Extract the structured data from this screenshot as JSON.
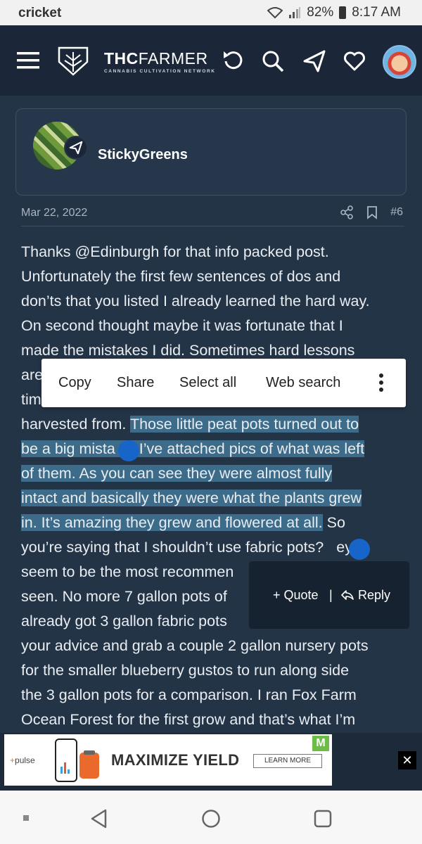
{
  "status_bar": {
    "carrier": "cricket",
    "battery": "82%",
    "time": "8:17 AM"
  },
  "header": {
    "logo_bold": "THC",
    "logo_light": "FARMER",
    "tagline": "CANNABIS CULTIVATION NETWORK",
    "icons": [
      "menu-icon",
      "logo-icon",
      "refresh-icon",
      "search-icon",
      "send-icon",
      "heart-icon",
      "avatar"
    ]
  },
  "post": {
    "username": "StickyGreens",
    "date": "Mar 22, 2022",
    "number": "#6",
    "lines": [
      "Thanks @Edinburgh for that info packed post.",
      "Unfortunately the first few sentences of dos and",
      "don’ts that you listed I already learned the hard way.",
      "On second thought maybe it was fortunate that I",
      "made the mistakes I did. Sometimes hard lessons",
      "are",
      "tim",
      "harvested from.",
      "Those little peat pots turned out to",
      "be a big mista",
      ". I’ve attached pics of what was left",
      "of them. As you can see they were almost fully",
      "intact and basically they were what the plants grew",
      "in. It’s amazing they grew and flowered at all.",
      "So",
      "you’re saying that I shouldn’t use fabric pots?",
      "ey",
      "seem to be the most recommen",
      "seen. No more 7 gallon pots of",
      "already got 3 gallon fabric pots",
      "your advice and grab a couple 2 gallon nursery pots",
      "for the smaller blueberry gustos to run along side",
      "the 3 gallon pots for a comparison. I ran Fox Farm",
      "Ocean Forest for the first grow and that’s what I’m"
    ]
  },
  "selection_toolbar": {
    "copy": "Copy",
    "share": "Share",
    "select_all": "Select all",
    "web_search": "Web search"
  },
  "quote_popup": {
    "quote": "+ Quote",
    "separator": "|",
    "reply": "Reply"
  },
  "ad": {
    "brand": "pulse",
    "headline": "MAXIMIZE YIELD",
    "cta": "LEARN MORE",
    "logo_letter": "M",
    "close": "✕"
  },
  "colors": {
    "header_bg": "#1b2738",
    "content_bg": "#243447",
    "highlight": "#3d6b8a",
    "handle": "#1865c9"
  }
}
